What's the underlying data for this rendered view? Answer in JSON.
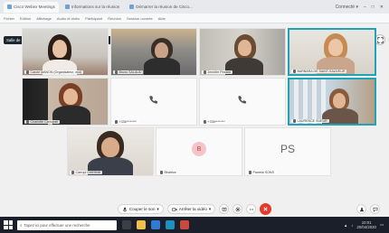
{
  "browser": {
    "tabs": [
      {
        "label": "Cisco Webex Meetings"
      },
      {
        "label": "Informations sur la réunion"
      },
      {
        "label": "Démarrer la réunion de Cisco..."
      }
    ],
    "window_controls_label": "Connecté ▾",
    "bookmarks": [
      "Fichier",
      "Edition",
      "Affichage",
      "Audio et vidéo",
      "Participant",
      "Réunion",
      "Session ouverte",
      "Aide"
    ]
  },
  "meeting": {
    "title": "Salle de partie : LAURENCE SUEUR, BARBARA DE S...",
    "participants": [
      {
        "name": "Carole MANON (Organisateur, moi)",
        "kind": "video"
      },
      {
        "name": "Bruno SALAUD",
        "kind": "video"
      },
      {
        "name": "Jennifer Pezzini",
        "kind": "video"
      },
      {
        "name": "BARBARA DE SAINT-SAUVEUR",
        "kind": "video",
        "active": true
      },
      {
        "name": "Charlotte Carrupati",
        "kind": "video"
      },
      {
        "name": "+336********",
        "kind": "phone"
      },
      {
        "name": "+336********",
        "kind": "phone"
      },
      {
        "name": "LAURENCE SUEUR",
        "kind": "video",
        "active": true
      },
      {
        "name": "Carrupi CHESNE",
        "kind": "video"
      },
      {
        "name": "Béatrice",
        "kind": "avatar",
        "initials": "B"
      },
      {
        "name": "Pamela SONS",
        "kind": "initials",
        "initials": "PS"
      }
    ]
  },
  "controls": {
    "mute_label": "Couper le son",
    "video_label": "Arrêter la vidéo"
  },
  "taskbar": {
    "search_placeholder": "Tapez ici pour effectuer une recherche",
    "time": "10:01",
    "date": "20/04/2020"
  },
  "colors": {
    "active_speaker_border": "#20a3b4",
    "leave_button": "#e23b2e",
    "header_bg": "#1d2731"
  }
}
